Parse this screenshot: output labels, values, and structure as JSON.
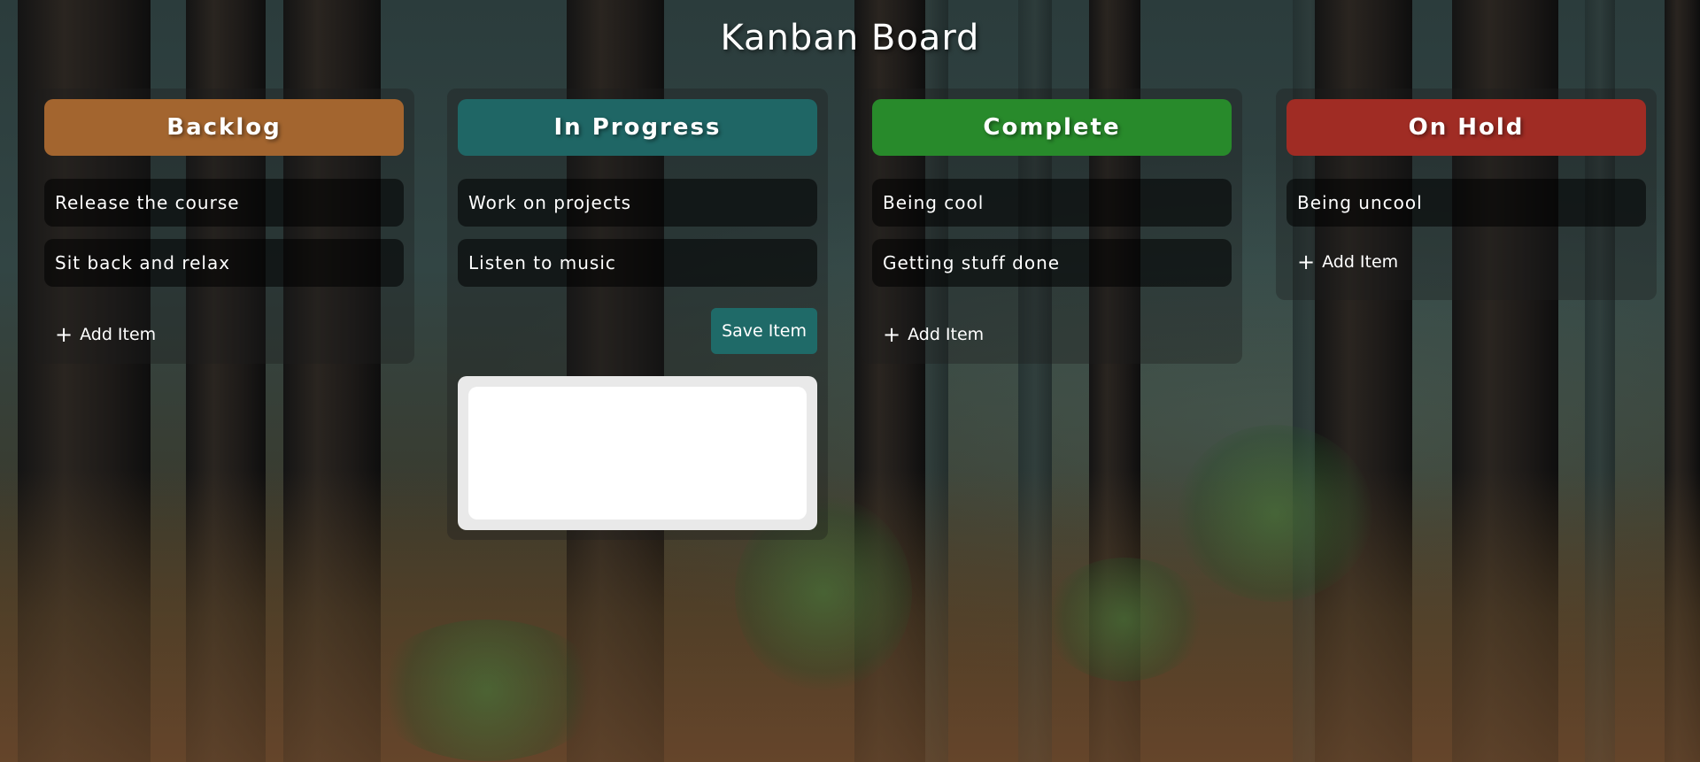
{
  "page": {
    "title": "Kanban Board"
  },
  "colors": {
    "backlog": "#a3652f",
    "in_progress": "#1f6665",
    "complete": "#288a2b",
    "on_hold": "#a02c24",
    "save_button": "#1f6a68"
  },
  "columns": [
    {
      "label": "Backlog",
      "color": "#a3652f",
      "items": [
        "Release the course",
        "Sit back and relax"
      ],
      "add_label": "Add Item"
    },
    {
      "label": "In Progress",
      "color": "#1f6665",
      "items": [
        "Work on projects",
        "Listen to music"
      ],
      "save_label": "Save Item",
      "new_item_value": ""
    },
    {
      "label": "Complete",
      "color": "#288a2b",
      "items": [
        "Being cool",
        "Getting stuff done"
      ],
      "add_label": "Add Item"
    },
    {
      "label": "On Hold",
      "color": "#a02c24",
      "items": [
        "Being uncool"
      ],
      "add_label": "Add Item"
    }
  ],
  "icons": {
    "add": "+"
  }
}
